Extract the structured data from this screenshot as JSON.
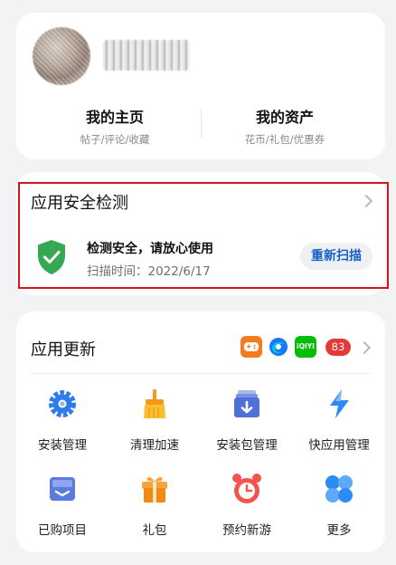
{
  "profile": {
    "home_title": "我的主页",
    "home_sub": "帖子/评论/收藏",
    "assets_title": "我的资产",
    "assets_sub": "花币/礼包/优惠券"
  },
  "security": {
    "title": "应用安全检测",
    "status": "检测安全，请放心使用",
    "scan_time": "扫描时间：2022/6/17",
    "rescan_label": "重新扫描",
    "status_color": "#34a853"
  },
  "updates": {
    "title": "应用更新",
    "app_icons": [
      "game-app-icon",
      "browser-app-icon",
      "iqiyi-app-icon"
    ],
    "iqiyi_text": "iQIYI",
    "count": "83",
    "items": [
      {
        "label": "安装管理",
        "icon": "gear-icon"
      },
      {
        "label": "清理加速",
        "icon": "broom-icon"
      },
      {
        "label": "安装包管理",
        "icon": "package-icon"
      },
      {
        "label": "快应用管理",
        "icon": "lightning-icon"
      },
      {
        "label": "已购项目",
        "icon": "purchased-icon"
      },
      {
        "label": "礼包",
        "icon": "gift-icon"
      },
      {
        "label": "预约新游",
        "icon": "alarm-clock-icon"
      },
      {
        "label": "更多",
        "icon": "more-icon"
      }
    ]
  }
}
